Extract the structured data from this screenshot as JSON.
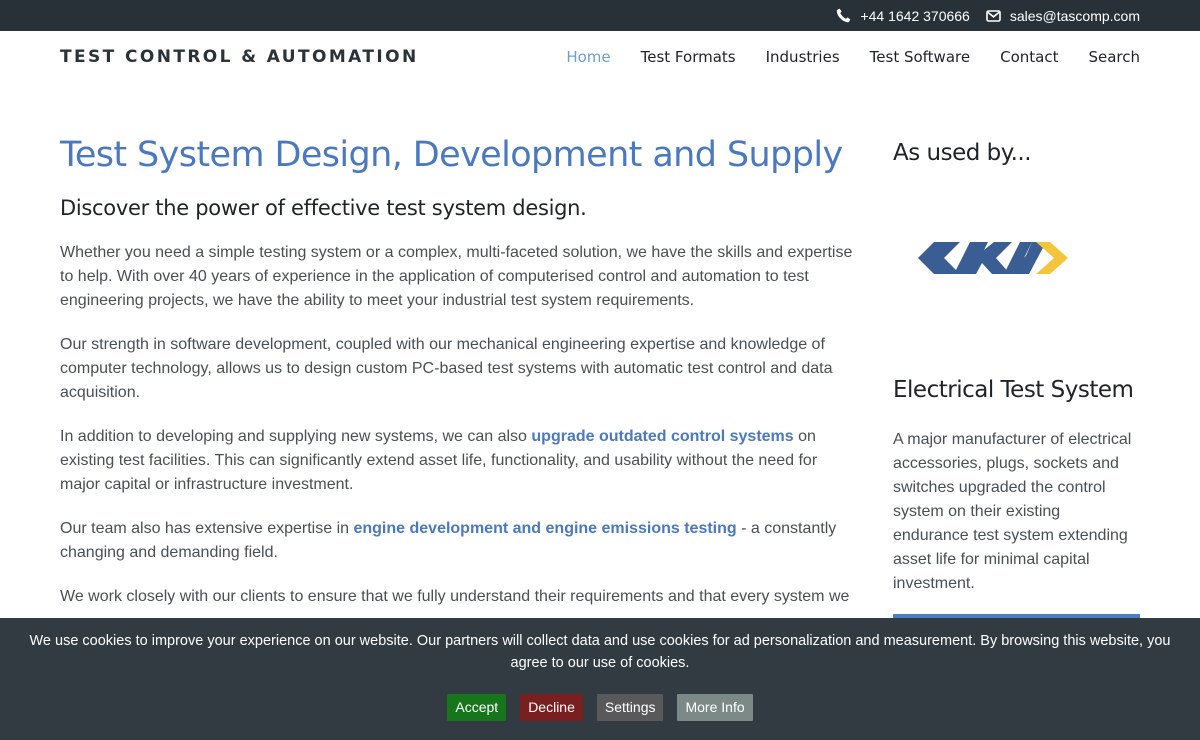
{
  "topbar": {
    "phone": "+44 1642 370666",
    "email": "sales@tascomp.com",
    "icons": [
      "phone-icon",
      "envelope-icon"
    ]
  },
  "header": {
    "brand": "TEST CONTROL & AUTOMATION",
    "nav": [
      "Home",
      "Test Formats",
      "Industries",
      "Test Software",
      "Contact",
      "Search"
    ],
    "active": "Home"
  },
  "main": {
    "title": "Test System Design, Development and Supply",
    "subtitle": "Discover the power of effective test system design.",
    "p1": "Whether you need a simple testing system or a complex, multi-faceted solution, we have the skills and expertise to help. With over 40 years of experience in the application of computerised control and automation to test engineering projects, we have the ability to meet your industrial test system requirements.",
    "p2": "Our strength in software development, coupled with our mechanical engineering expertise and knowledge of computer technology, allows us to design custom PC-based test systems with automatic test control and data acquisition.",
    "p3_before": "In addition to developing and supplying new systems, we can also ",
    "p3_link": "upgrade outdated control systems",
    "p3_after": " on existing test facilities. This can significantly extend asset life, functionality, and usability without the need for major capital or infrastructure investment.",
    "p4_before": "Our team also has extensive expertise in ",
    "p4_link": "engine development and engine emissions testing",
    "p4_after": " - a constantly changing and demanding field.",
    "p5": "We work closely with our clients to ensure that we fully understand their requirements and that every system we"
  },
  "sidebar": {
    "heading1": "As used by...",
    "heading2": "Electrical Test System",
    "text": "A major manufacturer of electrical accessories, plugs, sockets and switches upgraded the control system on their existing endurance test system extending asset life for minimal capital investment."
  },
  "cookie": {
    "message": "We use cookies to improve your experience on our website. Our partners will collect data and use cookies for ad personalization and measurement. By browsing this website, you agree to our use of cookies.",
    "accept": "Accept",
    "decline": "Decline",
    "settings": "Settings",
    "more": "More Info"
  },
  "colors": {
    "accent": "#4b79bf",
    "topbar": "#283038",
    "cookie_bg": "#323a42",
    "accept": "#17751c",
    "decline": "#7a1f1f"
  }
}
